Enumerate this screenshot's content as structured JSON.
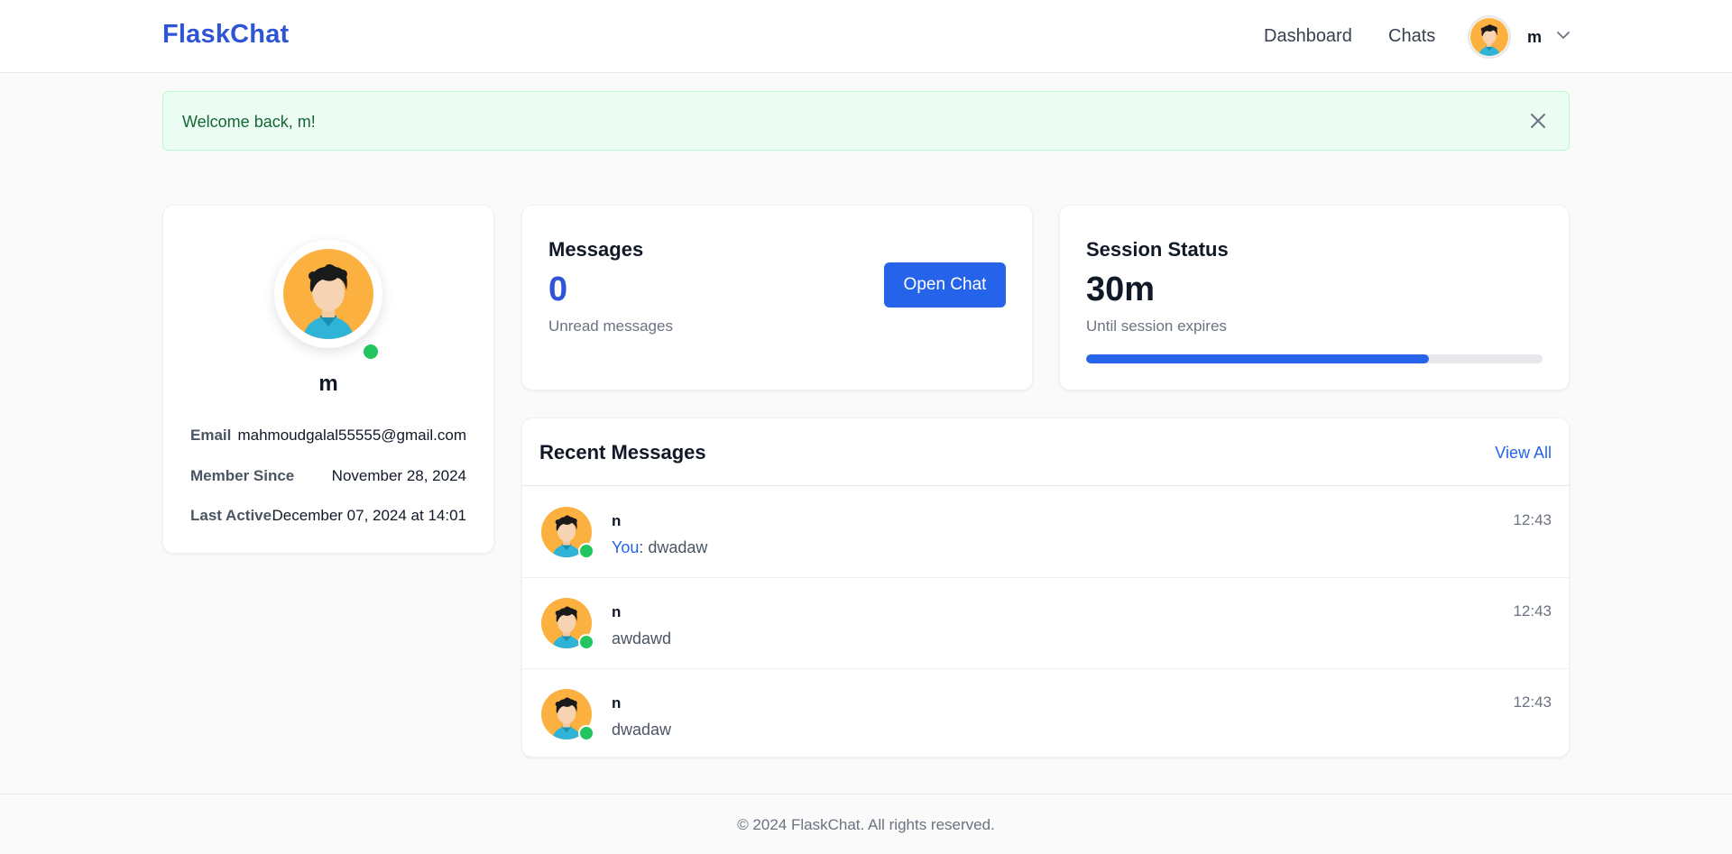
{
  "navbar": {
    "brand": "FlaskChat",
    "links": [
      "Dashboard",
      "Chats"
    ],
    "username": "m",
    "chevron_icon": "chevron-down-icon"
  },
  "alert": {
    "message": "Welcome back, m!",
    "close_icon": "close-icon"
  },
  "profile": {
    "name": "m",
    "status": "online",
    "email_label": "Email",
    "email": "mahmoudgalal55555@gmail.com",
    "member_since_label": "Member Since",
    "member_since": "November 28, 2024",
    "last_active_label": "Last Active",
    "last_active": "December 07, 2024 at 14:01"
  },
  "messages_card": {
    "title": "Messages",
    "count": "0",
    "subtitle": "Unread messages",
    "button_label": "Open Chat"
  },
  "session_card": {
    "title": "Session Status",
    "value": "30m",
    "subtitle": "Until session expires",
    "progress_percent": 75
  },
  "recent_messages": {
    "title": "Recent Messages",
    "view_all_label": "View All",
    "items": [
      {
        "name": "n",
        "prefix": "You",
        "preview": ": dwadaw",
        "time": "12:43",
        "status": "online"
      },
      {
        "name": "n",
        "prefix": "",
        "preview": "awdawd",
        "time": "12:43",
        "status": "online"
      },
      {
        "name": "n",
        "prefix": "",
        "preview": "dwadaw",
        "time": "12:43",
        "status": "online"
      }
    ]
  },
  "footer": {
    "text": "© 2024 FlaskChat. All rights reserved."
  },
  "colors": {
    "brand": "#2f55d4",
    "primary": "#2563eb",
    "online": "#22c55e",
    "alert_bg": "#ecfdf3",
    "avatar_bg": "#fbb040"
  }
}
